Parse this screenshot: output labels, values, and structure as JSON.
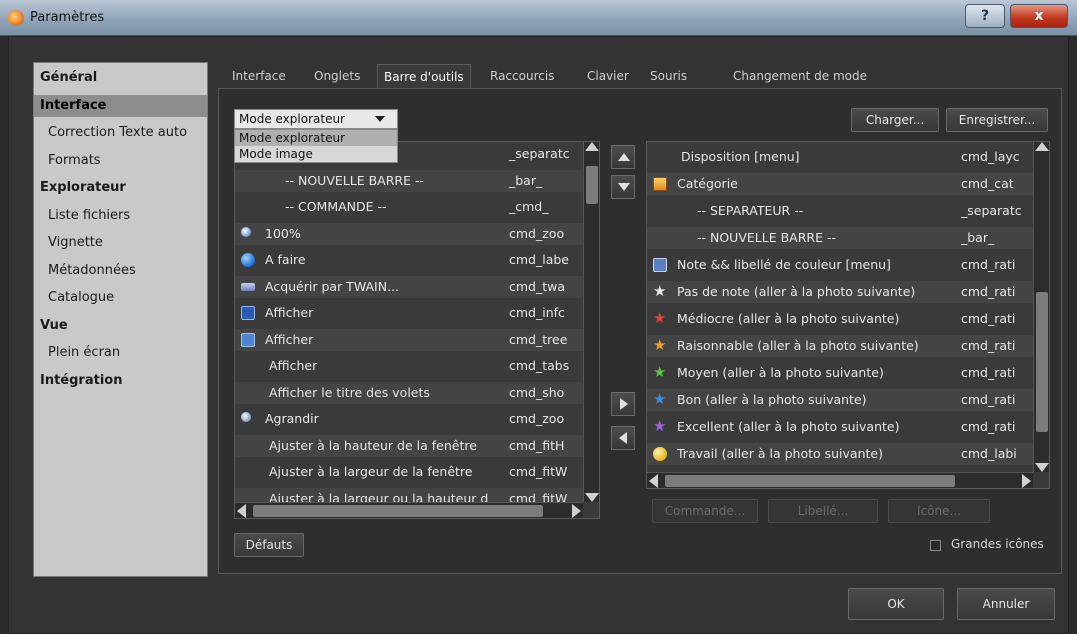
{
  "window": {
    "title": "Paramètres",
    "help_label": "?",
    "close_label": "x"
  },
  "nav": [
    {
      "label": "Général",
      "bold": true
    },
    {
      "label": "Interface",
      "bold": true,
      "selected": true
    },
    {
      "label": "Correction Texte auto",
      "sub": true
    },
    {
      "label": "Formats",
      "sub": true
    },
    {
      "label": "Explorateur",
      "bold": true
    },
    {
      "label": "Liste fichiers",
      "sub": true
    },
    {
      "label": "Vignette",
      "sub": true
    },
    {
      "label": "Métadonnées",
      "sub": true
    },
    {
      "label": "Catalogue",
      "sub": true
    },
    {
      "label": "Vue",
      "bold": true
    },
    {
      "label": "Plein écran",
      "sub": true
    },
    {
      "label": "Intégration",
      "bold": true
    }
  ],
  "tabs": [
    "Interface",
    "Onglets",
    "Barre d'outils",
    "Raccourcis",
    "Clavier",
    "Souris",
    "Changement de mode"
  ],
  "active_tab": "Barre d'outils",
  "mode_select": {
    "value": "Mode explorateur",
    "options": [
      "Mode explorateur",
      "Mode image"
    ]
  },
  "buttons": {
    "charger": "Charger...",
    "enregistrer": "Enregistrer...",
    "defauts": "Défauts",
    "commande": "Commande...",
    "libelle": "Libellé...",
    "icone": "Icône...",
    "ok": "OK",
    "annuler": "Annuler"
  },
  "grandes_icones_label": "Grandes icônes",
  "left_list": [
    {
      "name": "",
      "cmd": "_separatc",
      "icon": ""
    },
    {
      "name": "-- NOUVELLE BARRE --",
      "cmd": "_bar_",
      "icon": ""
    },
    {
      "name": "-- COMMANDE --",
      "cmd": "_cmd_",
      "icon": ""
    },
    {
      "name": "100%",
      "cmd": "cmd_zoo",
      "icon": "magnifier-icon"
    },
    {
      "name": "A faire",
      "cmd": "cmd_labe",
      "icon": "blue-dot-icon"
    },
    {
      "name": "Acquérir par TWAIN...",
      "cmd": "cmd_twa",
      "icon": "scanner-icon"
    },
    {
      "name": "Afficher",
      "cmd": "cmd_infc",
      "icon": "info-icon"
    },
    {
      "name": "Afficher",
      "cmd": "cmd_tree",
      "icon": "tree-icon"
    },
    {
      "name": "Afficher",
      "cmd": "cmd_tabs",
      "icon": ""
    },
    {
      "name": "Afficher le titre des volets",
      "cmd": "cmd_sho",
      "icon": ""
    },
    {
      "name": "Agrandir",
      "cmd": "cmd_zoo",
      "icon": "zoom-in-icon"
    },
    {
      "name": "Ajuster à la hauteur de la fenêtre",
      "cmd": "cmd_fitH",
      "icon": ""
    },
    {
      "name": "Ajuster à la largeur de la fenêtre",
      "cmd": "cmd_fitW",
      "icon": ""
    },
    {
      "name": "Ajuster à la largeur ou la hauteur d",
      "cmd": "cmd_fitW",
      "icon": ""
    }
  ],
  "right_list": [
    {
      "name": "Disposition [menu]",
      "cmd": "cmd_layc",
      "icon": ""
    },
    {
      "name": "Catégorie",
      "cmd": "cmd_cat",
      "icon": "category-icon"
    },
    {
      "name": "-- SEPARATEUR --",
      "cmd": "_separatc",
      "icon": ""
    },
    {
      "name": "-- NOUVELLE BARRE --",
      "cmd": "_bar_",
      "icon": ""
    },
    {
      "name": "Note && libellé de couleur [menu]",
      "cmd": "cmd_rati",
      "icon": "rating-icon"
    },
    {
      "name": "Pas de note (aller à la photo suivante)",
      "cmd": "cmd_rati",
      "icon": "star-white-icon"
    },
    {
      "name": "Médiocre (aller à la photo suivante)",
      "cmd": "cmd_rati",
      "icon": "star-red-icon"
    },
    {
      "name": "Raisonnable (aller à la photo suivante)",
      "cmd": "cmd_rati",
      "icon": "star-orange-icon"
    },
    {
      "name": "Moyen (aller à la photo suivante)",
      "cmd": "cmd_rati",
      "icon": "star-green-icon"
    },
    {
      "name": "Bon (aller à la photo suivante)",
      "cmd": "cmd_rati",
      "icon": "star-blue-icon"
    },
    {
      "name": "Excellent (aller à la photo suivante)",
      "cmd": "cmd_rati",
      "icon": "star-purple-icon"
    },
    {
      "name": "Travail (aller à la photo suivante)",
      "cmd": "cmd_labi",
      "icon": "yellow-dot-icon"
    }
  ],
  "colors": {
    "nav_bg": "#c9c9c9",
    "panel_bg": "#2e2e2e",
    "list_bg": "#3a3a3a"
  }
}
